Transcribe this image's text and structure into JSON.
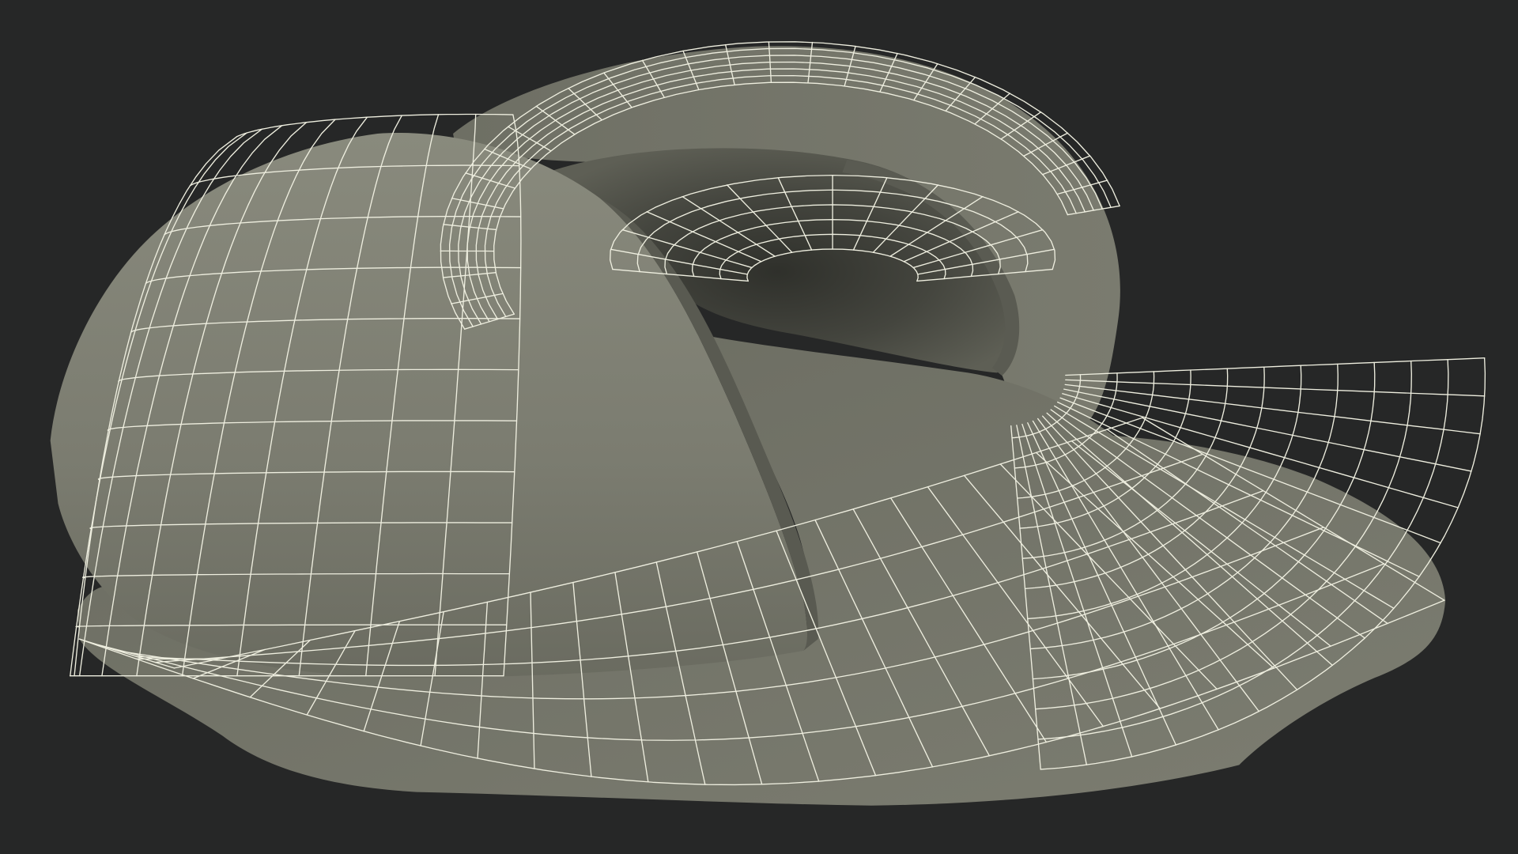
{
  "scene": {
    "subject": "wireframe-3d-model",
    "colors": {
      "background": "#262727",
      "surface_light": "#7d7e72",
      "surface_mid": "#6f7064",
      "surface_dark": "#4a4b43",
      "surface_shadow": "#34352f",
      "wire": "#eeeedf"
    }
  }
}
